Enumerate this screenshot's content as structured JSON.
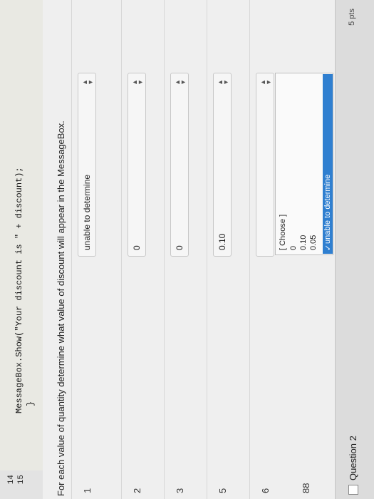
{
  "code": {
    "line_numbers": [
      "14",
      "15"
    ],
    "lines": [
      "MessageBox.Show(\"Your discount is \" + discount);",
      "}"
    ]
  },
  "question": {
    "prompt": "For each value of quantity determine what value of discount will appear in the MessageBox.",
    "rows": [
      {
        "quantity": "1",
        "selected": "unable to determine"
      },
      {
        "quantity": "2",
        "selected": "0"
      },
      {
        "quantity": "3",
        "selected": "0"
      },
      {
        "quantity": "5",
        "selected": "0.10"
      },
      {
        "quantity": "6",
        "selected": ""
      },
      {
        "quantity": "88",
        "selected": ""
      }
    ],
    "dropdown_options": [
      "[ Choose ]",
      "0",
      "0.10",
      "0.05",
      "unable to determine"
    ],
    "dropdown_highlighted": "unable to determine",
    "checkmark": "✓"
  },
  "question2": {
    "title": "Question 2",
    "points": "5 pts"
  }
}
